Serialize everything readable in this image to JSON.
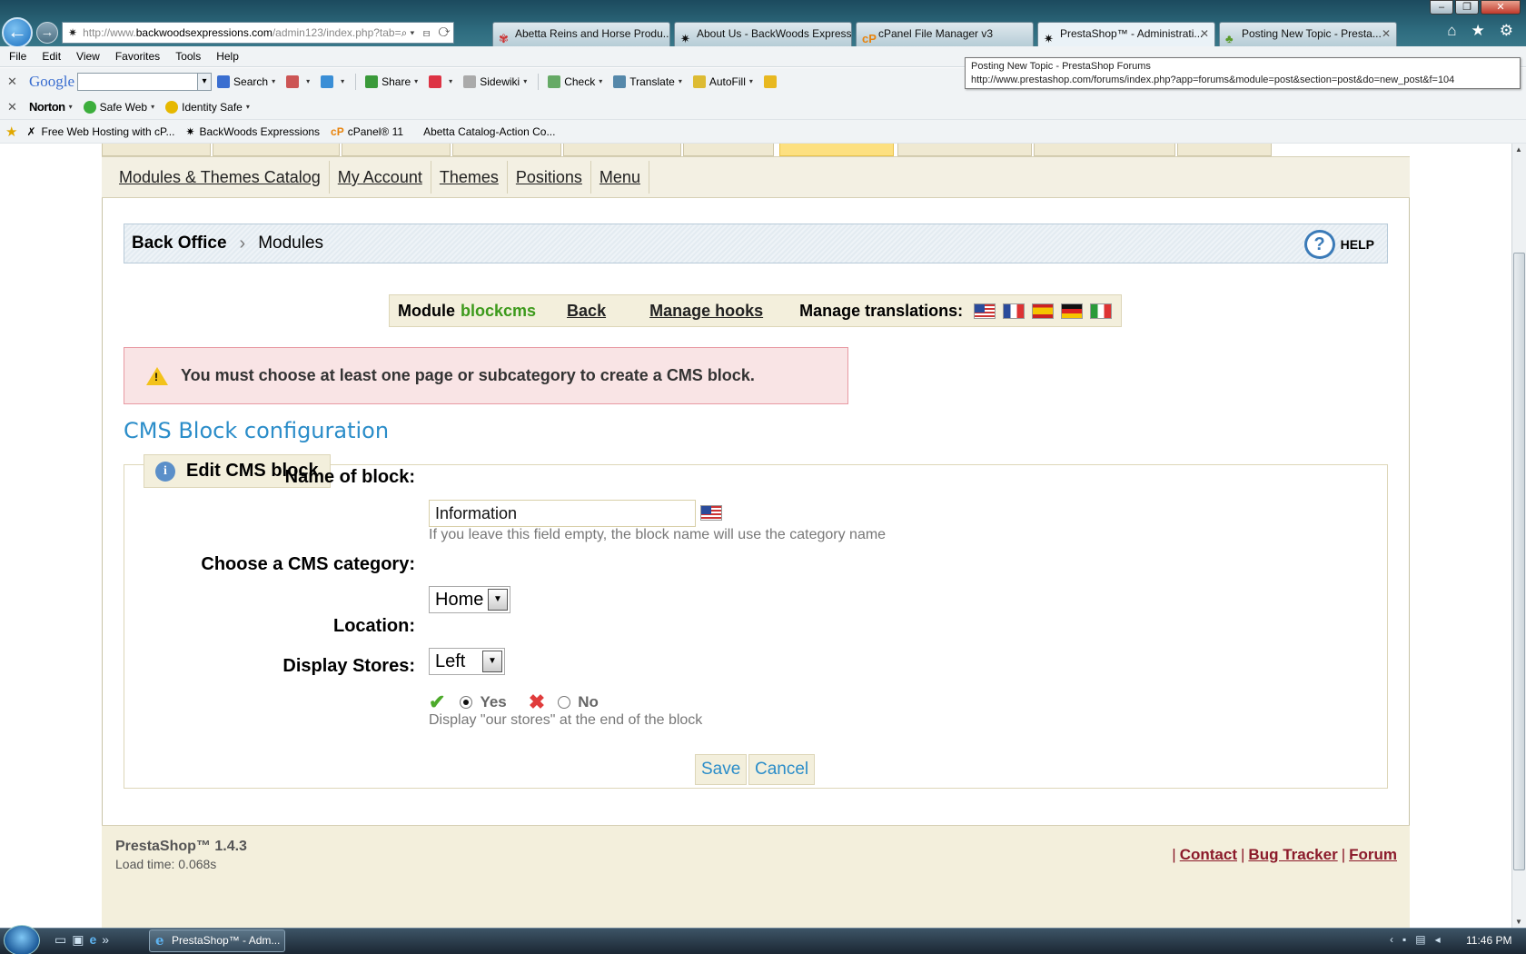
{
  "browser": {
    "address": {
      "prefix": "http://www.",
      "domain": "backwoodsexpressions.com",
      "path": "/admin123/index.php?tab=",
      "controls": "⌕▾ ⊟ ⟳ ✕"
    },
    "tabs": [
      {
        "label": "Abetta Reins and Horse Produ...",
        "active": false
      },
      {
        "label": "About Us - BackWoods Express...",
        "active": false
      },
      {
        "label": "cPanel File Manager v3",
        "active": false
      },
      {
        "label": "PrestaShop™ - Administrati...",
        "active": true
      },
      {
        "label": "Posting New Topic - Presta...",
        "active": false
      }
    ],
    "menu": [
      "File",
      "Edit",
      "View",
      "Favorites",
      "Tools",
      "Help"
    ],
    "tooltip": {
      "title": "Posting New Topic - PrestaShop Forums",
      "url": "http://www.prestashop.com/forums/index.php?app=forums&module=post&section=post&do=new_post&f=104"
    },
    "google_toolbar": {
      "logo": "Google",
      "items": [
        "Search",
        "Share",
        "Sidewiki",
        "Check",
        "Translate",
        "AutoFill"
      ]
    },
    "norton_toolbar": {
      "logo": "Norton",
      "items": [
        "Safe Web",
        "Identity Safe"
      ]
    },
    "favorites": [
      "Free Web Hosting with cP...",
      "BackWoods Expressions",
      "cPanel® 11",
      "Abetta Catalog-Action Co..."
    ]
  },
  "subnav": [
    "Modules & Themes Catalog",
    "My Account",
    "Themes",
    "Positions",
    "Menu"
  ],
  "breadcrumb": {
    "root": "Back Office",
    "current": "Modules",
    "help": "HELP"
  },
  "modbar": {
    "module_label": "Module",
    "module_name": "blockcms",
    "back": "Back",
    "hooks": "Manage hooks",
    "translations": "Manage translations:"
  },
  "warning": "You must choose at least one page or subcategory to create a CMS block.",
  "config_title": "CMS Block configuration",
  "form": {
    "legend": "Edit CMS block",
    "name_label": "Name of block:",
    "name_value": "Information",
    "name_hint": "If you leave this field empty, the block name will use the category name",
    "category_label": "Choose a CMS category:",
    "category_value": "Home",
    "location_label": "Location:",
    "location_value": "Left",
    "stores_label": "Display Stores:",
    "stores_yes": "Yes",
    "stores_no": "No",
    "stores_hint": "Display \"our stores\" at the end of the block",
    "save": "Save",
    "cancel": "Cancel"
  },
  "footer": {
    "version": "PrestaShop™ 1.4.3",
    "load_time": "Load time: 0.068s",
    "links": [
      "Contact",
      "Bug Tracker",
      "Forum"
    ]
  },
  "taskbar": {
    "item": "PrestaShop™ - Adm...",
    "clock": "11:46 PM"
  },
  "colors": {
    "accent_blue": "#2b8dc9",
    "module_green": "#3c9a1b",
    "warning_bg": "#f9e4e5",
    "panel_beige": "#f3efdc"
  }
}
